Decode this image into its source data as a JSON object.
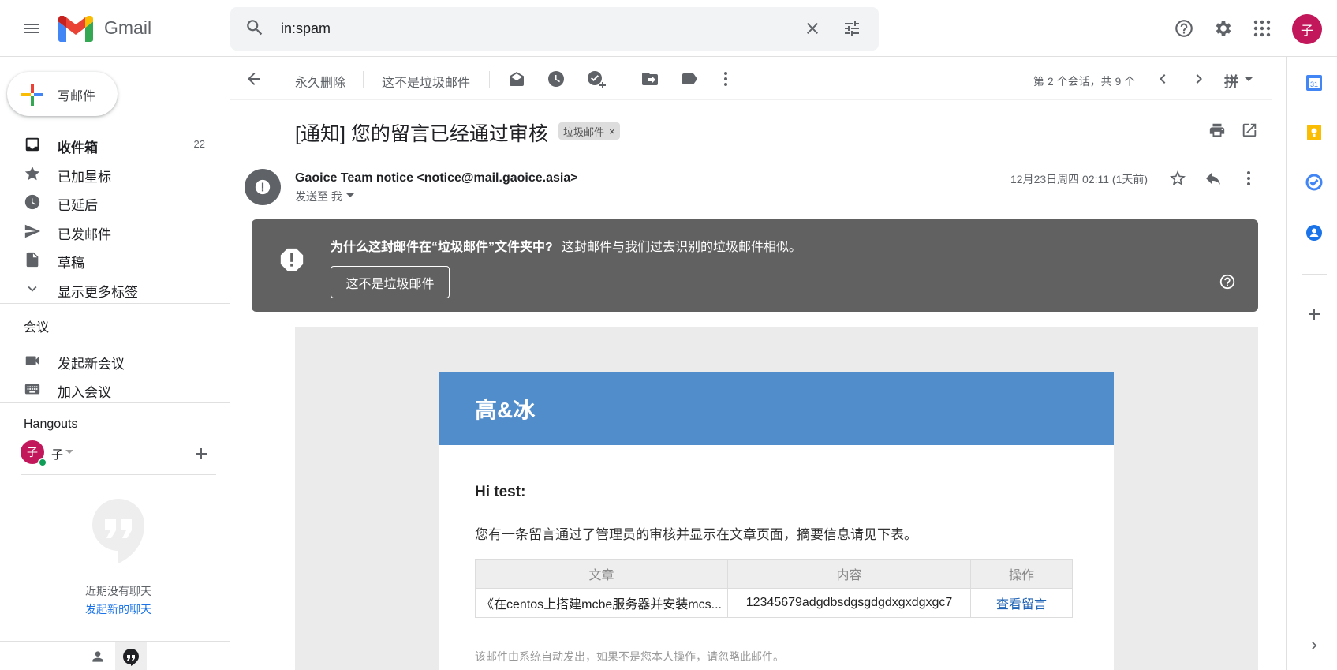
{
  "app": {
    "logo_text": "Gmail"
  },
  "search": {
    "value": "in:spam"
  },
  "account": {
    "avatar_letter": "子"
  },
  "compose": {
    "label": "写邮件"
  },
  "nav": [
    {
      "id": "inbox",
      "label": "收件箱",
      "count": "22",
      "icon": "inbox-icon"
    },
    {
      "id": "starred",
      "label": "已加星标",
      "icon": "star-icon"
    },
    {
      "id": "snoozed",
      "label": "已延后",
      "icon": "clock-icon"
    },
    {
      "id": "sent",
      "label": "已发邮件",
      "icon": "send-icon"
    },
    {
      "id": "drafts",
      "label": "草稿",
      "icon": "draft-icon"
    },
    {
      "id": "more",
      "label": "显示更多标签",
      "icon": "chevron-down-icon"
    }
  ],
  "meet": {
    "title": "会议",
    "new_meeting": "发起新会议",
    "join_meeting": "加入会议"
  },
  "hangouts": {
    "title": "Hangouts",
    "user_name": "子",
    "user_avatar": "子",
    "empty_text": "近期没有聊天",
    "start_chat": "发起新的聊天"
  },
  "toolbar": {
    "delete_forever": "永久删除",
    "not_spam": "这不是垃圾邮件",
    "pagination": "第 2 个会话，共 9 个",
    "input_tool": "拼"
  },
  "message": {
    "subject": "[通知] 您的留言已经通过审核",
    "label_chip": "垃圾邮件",
    "sender": "Gaoice Team notice <notice@mail.gaoice.asia>",
    "to": "发送至 我",
    "date": "12月23日周四 02:11 (1天前)"
  },
  "banner": {
    "title": "为什么这封邮件在“垃圾邮件”文件夹中?",
    "text": "这封邮件与我们过去识别的垃圾邮件相似。",
    "button": "这不是垃圾邮件"
  },
  "mail": {
    "brand": "高&冰",
    "greeting": "Hi test:",
    "intro": "您有一条留言通过了管理员的审核并显示在文章页面，摘要信息请见下表。",
    "table": {
      "headers": [
        "文章",
        "内容",
        "操作"
      ],
      "row": [
        "《在centos上搭建mcbe服务器并安装mcs...",
        "12345679adgdbsdgsgdgdxgxdgxgc7",
        "查看留言"
      ]
    },
    "footer": "该邮件由系统自动发出，如果不是您本人操作，请忽略此邮件。"
  },
  "colors": {
    "banner_bg": "#616161",
    "mail_header": "#518ccb",
    "avatar": "#c2185b",
    "link": "#1a73e8"
  }
}
